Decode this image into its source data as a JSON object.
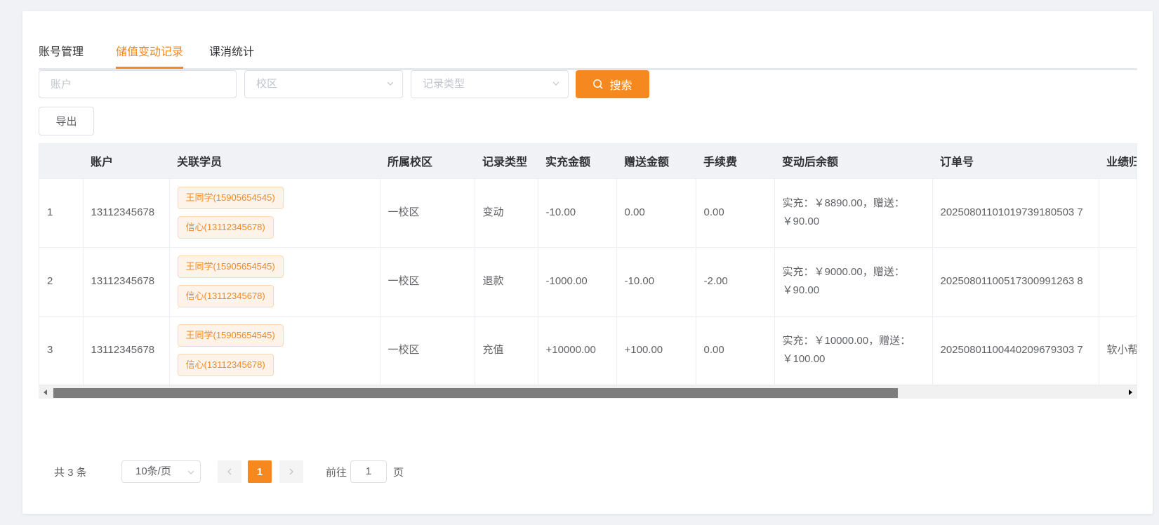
{
  "tabs": [
    {
      "label": "账号管理",
      "active": false
    },
    {
      "label": "储值变动记录",
      "active": true
    },
    {
      "label": "课消统计",
      "active": false
    }
  ],
  "filters": {
    "account_placeholder": "账户",
    "campus_placeholder": "校区",
    "record_type_placeholder": "记录类型",
    "search_label": "搜索",
    "export_label": "导出"
  },
  "table": {
    "columns": [
      "",
      "账户",
      "关联学员",
      "所属校区",
      "记录类型",
      "实充金额",
      "赠送金额",
      "手续费",
      "变动后余额",
      "订单号",
      "业绩归"
    ],
    "rows": [
      {
        "index": "1",
        "account": "13112345678",
        "students": [
          "王同学(15905654545)",
          "信心(13112345678)"
        ],
        "campus": "一校区",
        "type": "变动",
        "real_amount": "-10.00",
        "gift_amount": "0.00",
        "fee": "0.00",
        "balance": "实充：￥8890.00，赠送：￥90.00",
        "order_no": "20250801101019739180503 7",
        "performance": ""
      },
      {
        "index": "2",
        "account": "13112345678",
        "students": [
          "王同学(15905654545)",
          "信心(13112345678)"
        ],
        "campus": "一校区",
        "type": "退款",
        "real_amount": "-1000.00",
        "gift_amount": "-10.00",
        "fee": "-2.00",
        "balance": "实充：￥9000.00，赠送：￥90.00",
        "order_no": "20250801100517300991263 8",
        "performance": ""
      },
      {
        "index": "3",
        "account": "13112345678",
        "students": [
          "王同学(15905654545)",
          "信心(13112345678)"
        ],
        "campus": "一校区",
        "type": "充值",
        "real_amount": "+10000.00",
        "gift_amount": "+100.00",
        "fee": "0.00",
        "balance": "实充：￥10000.00，赠送：￥100.00",
        "order_no": "20250801100440209679303 7",
        "performance": "软小帮"
      }
    ]
  },
  "pagination": {
    "total_label": "共 3 条",
    "page_size": "10条/页",
    "current_page": "1",
    "goto_label": "前往",
    "goto_value": "1",
    "page_suffix": "页"
  },
  "colors": {
    "accent": "#f5881e",
    "tag_bg": "#fef3e8",
    "tag_border": "#fbd8b5"
  }
}
